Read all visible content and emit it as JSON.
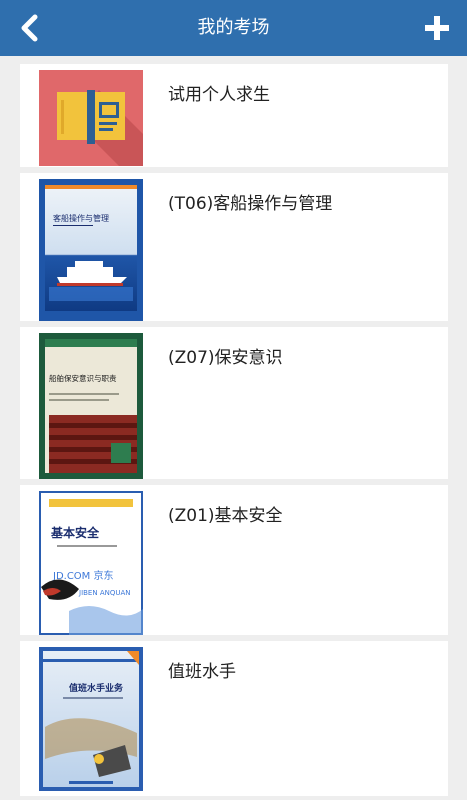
{
  "header": {
    "title": "我的考场",
    "back_icon": "chevron-left-icon",
    "add_icon": "plus-icon",
    "color": "#2f6fae"
  },
  "items": [
    {
      "name": "试用个人求生",
      "cover": {
        "kind": "book-icon",
        "color": "#e0686a"
      }
    },
    {
      "name": "(T06)客船操作与管理",
      "cover": {
        "kind": "book-cover",
        "title": "客船操作与管理"
      }
    },
    {
      "name": "(Z07)保安意识",
      "cover": {
        "kind": "book-cover",
        "title": "船舶保安意识与职责"
      }
    },
    {
      "name": "(Z01)基本安全",
      "cover": {
        "kind": "book-cover",
        "title": "基本安全",
        "subtitle": "JIBEN ANQUAN",
        "watermark": "JD.COM 京东"
      }
    },
    {
      "name": "值班水手",
      "cover": {
        "kind": "book-cover",
        "title": "值班水手业务"
      }
    }
  ]
}
